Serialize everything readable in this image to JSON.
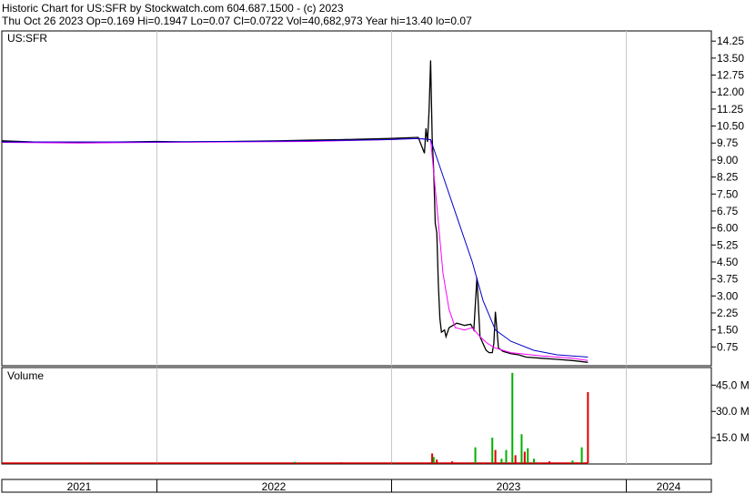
{
  "header": {
    "line1": "Historic Chart for US:SFR by Stockwatch.com 604.687.1500 - (c) 2023",
    "line2": "Thu Oct 26 2023   Op=0.169   Hi=0.1947   Lo=0.07   Cl=0.0722   Vol=40,682,973   Year hi=13.40   lo=0.07"
  },
  "colors": {
    "price": "#000000",
    "ma_fast": "#ff00ff",
    "ma_slow": "#0000c8",
    "vol_up": "#00b000",
    "vol_down": "#e00000",
    "grid": "#c8c8c8"
  },
  "chart_data": [
    {
      "type": "line",
      "panel_label": "US:SFR",
      "x_ticks": [
        "2021",
        "2022",
        "2023",
        "2024"
      ],
      "y_ticks": [
        "0.75",
        "1.50",
        "2.25",
        "3.00",
        "3.75",
        "4.50",
        "5.25",
        "6.00",
        "6.75",
        "7.50",
        "8.25",
        "9.00",
        "9.75",
        "10.50",
        "11.25",
        "12.00",
        "12.75",
        "13.50",
        "14.25"
      ],
      "ylim": [
        0,
        14.7
      ],
      "series": [
        {
          "key": "price",
          "x": [
            2020.0,
            2020.2,
            2020.5,
            2020.8,
            2021.0,
            2021.2,
            2021.5,
            2021.8,
            2022.0,
            2022.2,
            2022.5,
            2022.7,
            2022.74,
            2022.75,
            2022.76,
            2022.77,
            2022.78,
            2022.79,
            2022.8,
            2022.81,
            2022.82,
            2022.83,
            2022.84,
            2022.85,
            2022.87,
            2022.88,
            2022.9,
            2022.95,
            2023.0,
            2023.04,
            2023.06,
            2023.08,
            2023.1,
            2023.12,
            2023.14,
            2023.16,
            2023.18,
            2023.19,
            2023.2,
            2023.22,
            2023.25,
            2023.3,
            2023.35,
            2023.4,
            2023.5,
            2023.6,
            2023.7,
            2023.8
          ],
          "y": [
            9.85,
            9.8,
            9.78,
            9.8,
            9.82,
            9.8,
            9.82,
            9.85,
            9.88,
            9.9,
            9.95,
            10.0,
            9.3,
            10.4,
            9.8,
            11.2,
            13.4,
            10.0,
            8.5,
            6.2,
            5.8,
            3.5,
            2.0,
            1.4,
            1.5,
            1.2,
            1.6,
            1.8,
            1.7,
            1.75,
            1.5,
            3.8,
            1.2,
            0.9,
            0.6,
            0.5,
            0.5,
            0.9,
            2.3,
            0.7,
            0.55,
            0.45,
            0.4,
            0.3,
            0.25,
            0.2,
            0.15,
            0.07
          ]
        },
        {
          "key": "ma_fast",
          "x": [
            2020.0,
            2020.5,
            2021.0,
            2021.5,
            2022.0,
            2022.5,
            2022.7,
            2022.78,
            2022.82,
            2022.86,
            2022.9,
            2022.94,
            2023.0,
            2023.05,
            2023.1,
            2023.15,
            2023.2,
            2023.3,
            2023.5,
            2023.7,
            2023.8
          ],
          "y": [
            9.78,
            9.75,
            9.78,
            9.8,
            9.82,
            9.9,
            9.95,
            9.9,
            7.0,
            4.0,
            2.4,
            1.6,
            1.5,
            1.6,
            1.2,
            0.9,
            0.7,
            0.5,
            0.35,
            0.25,
            0.15
          ]
        },
        {
          "key": "ma_slow",
          "x": [
            2020.0,
            2020.5,
            2021.0,
            2021.5,
            2022.0,
            2022.5,
            2022.7,
            2022.78,
            2022.85,
            2022.95,
            2023.05,
            2023.12,
            2023.2,
            2023.3,
            2023.45,
            2023.6,
            2023.8
          ],
          "y": [
            9.8,
            9.8,
            9.8,
            9.82,
            9.85,
            9.9,
            9.95,
            9.9,
            8.5,
            6.5,
            4.5,
            2.8,
            1.5,
            1.0,
            0.6,
            0.4,
            0.3
          ]
        }
      ]
    },
    {
      "type": "bar",
      "panel_label": "Volume",
      "y_ticks": [
        "15.0 M",
        "30.0 M",
        "45.0 M"
      ],
      "ylim": [
        0,
        54
      ],
      "bars": [
        {
          "x": 2020.2,
          "v": 0.6,
          "up": false
        },
        {
          "x": 2020.6,
          "v": 0.8,
          "up": true
        },
        {
          "x": 2021.0,
          "v": 0.7,
          "up": false
        },
        {
          "x": 2021.4,
          "v": 0.6,
          "up": true
        },
        {
          "x": 2021.9,
          "v": 1.2,
          "up": true
        },
        {
          "x": 2022.2,
          "v": 0.9,
          "up": false
        },
        {
          "x": 2022.55,
          "v": 0.8,
          "up": true
        },
        {
          "x": 2022.79,
          "v": 6.0,
          "up": false
        },
        {
          "x": 2022.8,
          "v": 4.0,
          "up": true
        },
        {
          "x": 2022.82,
          "v": 2.5,
          "up": false
        },
        {
          "x": 2022.92,
          "v": 1.5,
          "up": false
        },
        {
          "x": 2023.07,
          "v": 9.5,
          "up": true
        },
        {
          "x": 2023.18,
          "v": 15.0,
          "up": true
        },
        {
          "x": 2023.2,
          "v": 8.0,
          "up": false
        },
        {
          "x": 2023.24,
          "v": 3.0,
          "up": true
        },
        {
          "x": 2023.27,
          "v": 8.0,
          "up": true
        },
        {
          "x": 2023.31,
          "v": 52.0,
          "up": true
        },
        {
          "x": 2023.33,
          "v": 5.0,
          "up": false
        },
        {
          "x": 2023.37,
          "v": 17.0,
          "up": true
        },
        {
          "x": 2023.39,
          "v": 7.0,
          "up": false
        },
        {
          "x": 2023.41,
          "v": 9.0,
          "up": true
        },
        {
          "x": 2023.45,
          "v": 3.0,
          "up": true
        },
        {
          "x": 2023.55,
          "v": 1.5,
          "up": false
        },
        {
          "x": 2023.7,
          "v": 2.0,
          "up": true
        },
        {
          "x": 2023.76,
          "v": 9.5,
          "up": true
        },
        {
          "x": 2023.8,
          "v": 41.0,
          "up": false
        }
      ]
    }
  ]
}
